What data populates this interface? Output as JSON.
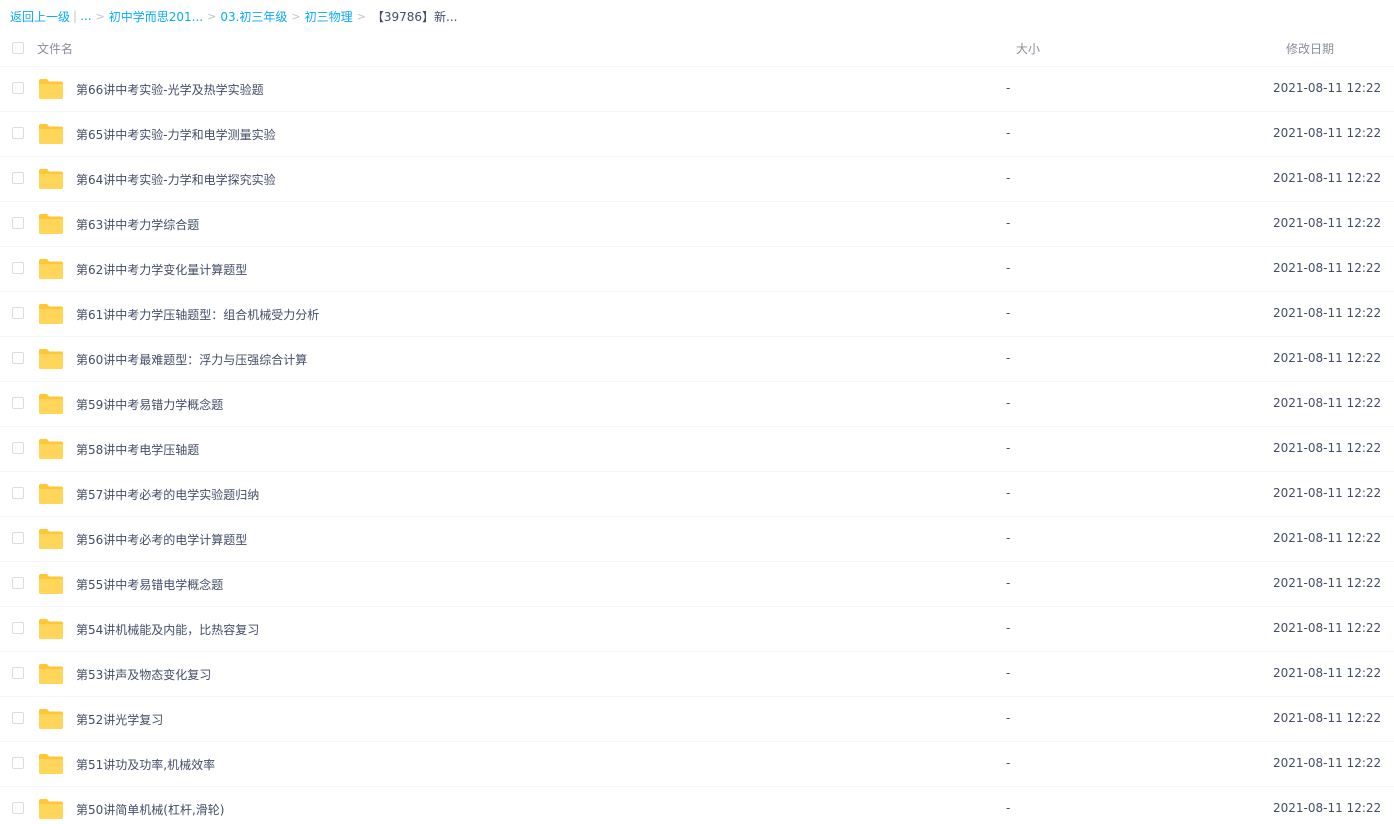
{
  "breadcrumb": {
    "back_label": "返回上一级",
    "bar": "|",
    "ellipsis": "...",
    "sep": ">",
    "items": [
      "初中学而思201...",
      "03.初三年级",
      "初三物理"
    ],
    "current": "【39786】新..."
  },
  "header": {
    "name_label": "文件名",
    "size_label": "大小",
    "date_label": "修改日期"
  },
  "folder_icon": "folder-icon",
  "colors": {
    "link": "#09aaff",
    "text": "#424e67",
    "folder": "#ffd659",
    "folder_tab": "#ffc734"
  },
  "rows": [
    {
      "name": "第66讲中考实验-光学及热学实验题",
      "size": "-",
      "date": "2021-08-11 12:22"
    },
    {
      "name": "第65讲中考实验-力学和电学测量实验",
      "size": "-",
      "date": "2021-08-11 12:22"
    },
    {
      "name": "第64讲中考实验-力学和电学探究实验",
      "size": "-",
      "date": "2021-08-11 12:22"
    },
    {
      "name": "第63讲中考力学综合题",
      "size": "-",
      "date": "2021-08-11 12:22"
    },
    {
      "name": "第62讲中考力学变化量计算题型",
      "size": "-",
      "date": "2021-08-11 12:22"
    },
    {
      "name": "第61讲中考力学压轴题型：组合机械受力分析",
      "size": "-",
      "date": "2021-08-11 12:22"
    },
    {
      "name": "第60讲中考最难题型：浮力与压强综合计算",
      "size": "-",
      "date": "2021-08-11 12:22"
    },
    {
      "name": "第59讲中考易错力学概念题",
      "size": "-",
      "date": "2021-08-11 12:22"
    },
    {
      "name": "第58讲中考电学压轴题",
      "size": "-",
      "date": "2021-08-11 12:22"
    },
    {
      "name": "第57讲中考必考的电学实验题归纳",
      "size": "-",
      "date": "2021-08-11 12:22"
    },
    {
      "name": "第56讲中考必考的电学计算题型",
      "size": "-",
      "date": "2021-08-11 12:22"
    },
    {
      "name": "第55讲中考易错电学概念题",
      "size": "-",
      "date": "2021-08-11 12:22"
    },
    {
      "name": "第54讲机械能及内能，比热容复习",
      "size": "-",
      "date": "2021-08-11 12:22"
    },
    {
      "name": "第53讲声及物态变化复习",
      "size": "-",
      "date": "2021-08-11 12:22"
    },
    {
      "name": "第52讲光学复习",
      "size": "-",
      "date": "2021-08-11 12:22"
    },
    {
      "name": "第51讲功及功率,机械效率",
      "size": "-",
      "date": "2021-08-11 12:22"
    },
    {
      "name": "第50讲简单机械(杠杆,滑轮)",
      "size": "-",
      "date": "2021-08-11 12:22"
    }
  ]
}
